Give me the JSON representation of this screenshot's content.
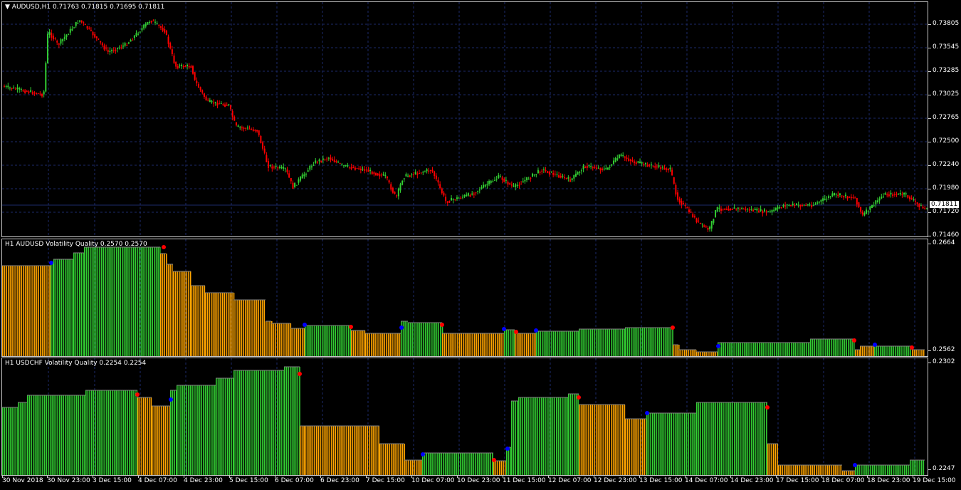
{
  "main_chart": {
    "title": "AUDUSD,H1",
    "ohlc": "0.71763 0.71815 0.71695 0.71811",
    "current_price": "0.71811",
    "price_labels": [
      "0.73805",
      "0.73545",
      "0.73285",
      "0.73025",
      "0.72765",
      "0.72500",
      "0.72240",
      "0.71980",
      "0.71720",
      "0.71460"
    ],
    "bull_color": "#32cd32",
    "bear_color": "#ff0000"
  },
  "indicator1": {
    "title": "H1 AUDUSD Volatility Quality 0.2570 0.2570",
    "scale_labels": [
      "0.2664",
      "0.2562"
    ]
  },
  "indicator2": {
    "title": "H1 USDCHF Volatility Quality 0.2254 0.2254",
    "scale_labels": [
      "0.2302",
      "0.2247"
    ]
  },
  "time_axis": [
    "30 Nov 2018",
    "30 Nov 23:00",
    "3 Dec 15:00",
    "4 Dec 07:00",
    "4 Dec 23:00",
    "5 Dec 15:00",
    "6 Dec 07:00",
    "6 Dec 23:00",
    "7 Dec 15:00",
    "10 Dec 07:00",
    "10 Dec 23:00",
    "11 Dec 15:00",
    "12 Dec 07:00",
    "12 Dec 23:00",
    "13 Dec 15:00",
    "14 Dec 07:00",
    "14 Dec 23:00",
    "17 Dec 15:00",
    "18 Dec 07:00",
    "18 Dec 23:00",
    "19 Dec 15:00"
  ],
  "colors": {
    "background": "#000000",
    "grid": "#1c2a6a",
    "vq_up": "#32cd32",
    "vq_down": "#ffa500",
    "dot_up": "#0000ff",
    "dot_down": "#ff0000"
  }
}
